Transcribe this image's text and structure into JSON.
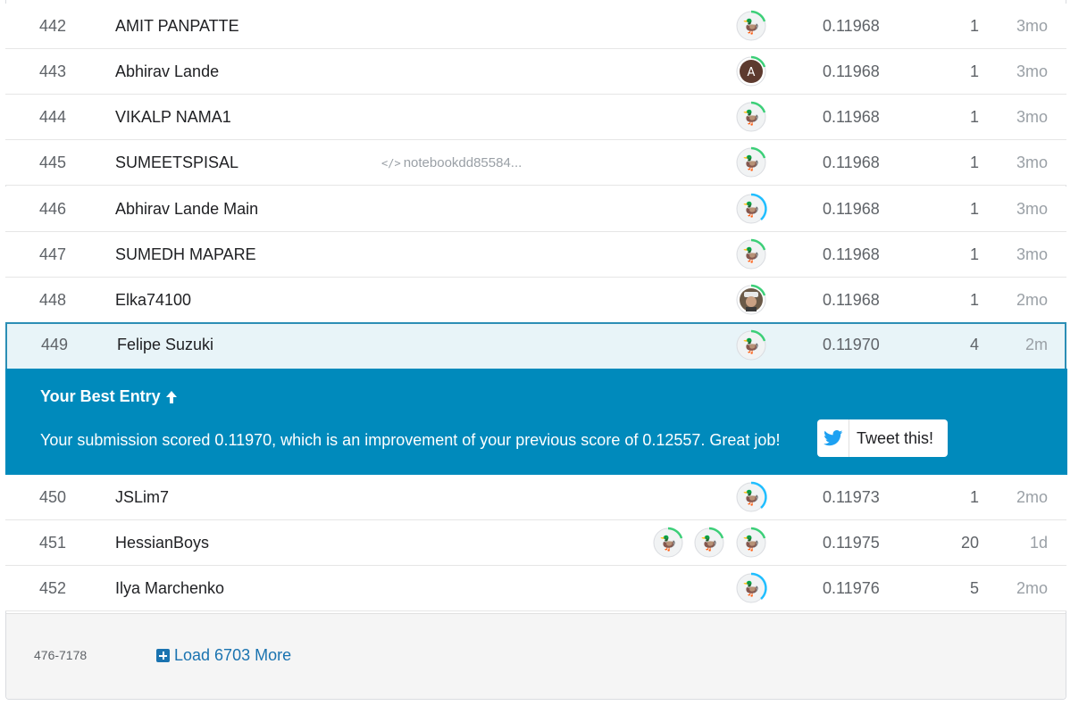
{
  "colors": {
    "banner_bg": "#008abc",
    "highlight_bg": "#e8f4f8",
    "highlight_border": "#2b8eb5",
    "ring_green": "#20beff",
    "ring_tier_green": "#3ccf78",
    "ring_tier_blue": "#20beff",
    "link_blue": "#1a73b0"
  },
  "rows_top": [
    {
      "rank": "442",
      "name": "AMIT PANPATTE",
      "notebook": "",
      "avatar": "default-green",
      "score": "0.11968",
      "entries": "1",
      "last": "3mo"
    },
    {
      "rank": "443",
      "name": "Abhirav Lande",
      "notebook": "",
      "avatar": "letter-a",
      "score": "0.11968",
      "entries": "1",
      "last": "3mo"
    },
    {
      "rank": "444",
      "name": "VIKALP NAMA1",
      "notebook": "",
      "avatar": "default-green",
      "score": "0.11968",
      "entries": "1",
      "last": "3mo"
    },
    {
      "rank": "445",
      "name": "SUMEETSPISAL",
      "notebook": "notebookdd85584...",
      "avatar": "default-green",
      "score": "0.11968",
      "entries": "1",
      "last": "3mo"
    },
    {
      "rank": "446",
      "name": "Abhirav Lande Main",
      "notebook": "",
      "avatar": "default-blue",
      "score": "0.11968",
      "entries": "1",
      "last": "3mo"
    },
    {
      "rank": "447",
      "name": "SUMEDH MAPARE",
      "notebook": "",
      "avatar": "default-green",
      "score": "0.11968",
      "entries": "1",
      "last": "3mo"
    },
    {
      "rank": "448",
      "name": "Elka74100",
      "notebook": "",
      "avatar": "photo",
      "score": "0.11968",
      "entries": "1",
      "last": "2mo"
    }
  ],
  "highlight_row": {
    "rank": "449",
    "name": "Felipe Suzuki",
    "avatar": "default-green",
    "score": "0.11970",
    "entries": "4",
    "last": "2m"
  },
  "banner": {
    "title": "Your Best Entry",
    "arrow_icon": "arrow-up-icon",
    "message": "Your submission scored 0.11970, which is an improvement of your previous score of 0.12557. Great job!",
    "tweet_label": "Tweet this!",
    "tweet_icon": "twitter-bird-icon"
  },
  "rows_bottom": [
    {
      "rank": "450",
      "name": "JSLim7",
      "avatars": [
        "default-blue"
      ],
      "score": "0.11973",
      "entries": "1",
      "last": "2mo"
    },
    {
      "rank": "451",
      "name": "HessianBoys",
      "avatars": [
        "default-green",
        "default-green",
        "default-green"
      ],
      "score": "0.11975",
      "entries": "20",
      "last": "1d"
    },
    {
      "rank": "452",
      "name": "Ilya Marchenko",
      "avatars": [
        "default-blue"
      ],
      "score": "0.11976",
      "entries": "5",
      "last": "2mo"
    }
  ],
  "footer": {
    "range": "476-7178",
    "load_more": "Load 6703 More",
    "load_icon": "plus-square-icon"
  }
}
